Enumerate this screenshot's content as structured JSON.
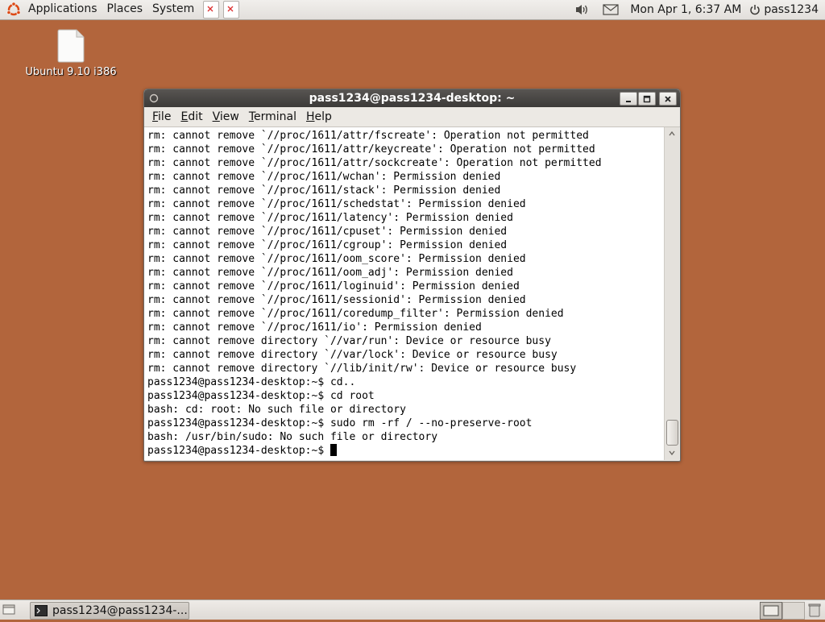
{
  "top_panel": {
    "menus": [
      "Applications",
      "Places",
      "System"
    ],
    "launchers": [
      "launcher-icon",
      "launcher-icon"
    ],
    "clock": "Mon Apr  1,  6:37 AM",
    "username": "pass1234",
    "tray_icons": [
      "volume-icon",
      "mail-icon",
      "power-icon"
    ]
  },
  "desktop": {
    "icon_label": "Ubuntu 9.10 i386",
    "background_color": "#b2653c"
  },
  "terminal": {
    "title": "pass1234@pass1234-desktop: ~",
    "menu": [
      {
        "label": "File",
        "mnemonic": "F"
      },
      {
        "label": "Edit",
        "mnemonic": "E"
      },
      {
        "label": "View",
        "mnemonic": "V"
      },
      {
        "label": "Terminal",
        "mnemonic": "T"
      },
      {
        "label": "Help",
        "mnemonic": "H"
      }
    ],
    "lines": [
      "rm: cannot remove `//proc/1611/attr/fscreate': Operation not permitted",
      "rm: cannot remove `//proc/1611/attr/keycreate': Operation not permitted",
      "rm: cannot remove `//proc/1611/attr/sockcreate': Operation not permitted",
      "rm: cannot remove `//proc/1611/wchan': Permission denied",
      "rm: cannot remove `//proc/1611/stack': Permission denied",
      "rm: cannot remove `//proc/1611/schedstat': Permission denied",
      "rm: cannot remove `//proc/1611/latency': Permission denied",
      "rm: cannot remove `//proc/1611/cpuset': Permission denied",
      "rm: cannot remove `//proc/1611/cgroup': Permission denied",
      "rm: cannot remove `//proc/1611/oom_score': Permission denied",
      "rm: cannot remove `//proc/1611/oom_adj': Permission denied",
      "rm: cannot remove `//proc/1611/loginuid': Permission denied",
      "rm: cannot remove `//proc/1611/sessionid': Permission denied",
      "rm: cannot remove `//proc/1611/coredump_filter': Permission denied",
      "rm: cannot remove `//proc/1611/io': Permission denied",
      "rm: cannot remove directory `//var/run': Device or resource busy",
      "rm: cannot remove directory `//var/lock': Device or resource busy",
      "rm: cannot remove directory `//lib/init/rw': Device or resource busy",
      "pass1234@pass1234-desktop:~$ cd..",
      "pass1234@pass1234-desktop:~$ cd root",
      "bash: cd: root: No such file or directory",
      "pass1234@pass1234-desktop:~$ sudo rm -rf / --no-preserve-root",
      "bash: /usr/bin/sudo: No such file or directory"
    ],
    "prompt": "pass1234@pass1234-desktop:~$ "
  },
  "bottom_panel": {
    "task_label": "pass1234@pass1234-..."
  }
}
